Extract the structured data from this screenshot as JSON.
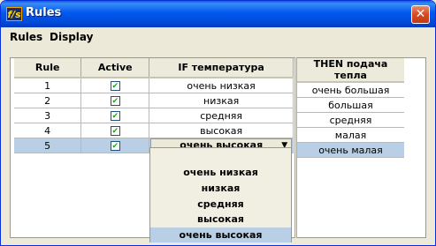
{
  "window": {
    "title": "Rules",
    "icon_text": "f/s",
    "close_label": "✕"
  },
  "menubar": {
    "items": [
      "Rules",
      "Display"
    ]
  },
  "rules_table": {
    "columns": [
      "Rule",
      "Active",
      "IF температура"
    ],
    "rows": [
      {
        "rule": "1",
        "active": true,
        "if": "очень низкая"
      },
      {
        "rule": "2",
        "active": true,
        "if": "низкая"
      },
      {
        "rule": "3",
        "active": true,
        "if": "средняя"
      },
      {
        "rule": "4",
        "active": true,
        "if": "высокая"
      },
      {
        "rule": "5",
        "active": true,
        "if": "очень высокая"
      }
    ],
    "selected_row": 4
  },
  "then_table": {
    "columns": [
      "THEN подача тепла"
    ],
    "rows": [
      "очень большая",
      "большая",
      "средняя",
      "малая",
      "очень малая"
    ]
  },
  "dropdown": {
    "options": [
      "очень низкая",
      "низкая",
      "средняя",
      "высокая",
      "очень высокая"
    ],
    "selected": "очень высокая"
  }
}
